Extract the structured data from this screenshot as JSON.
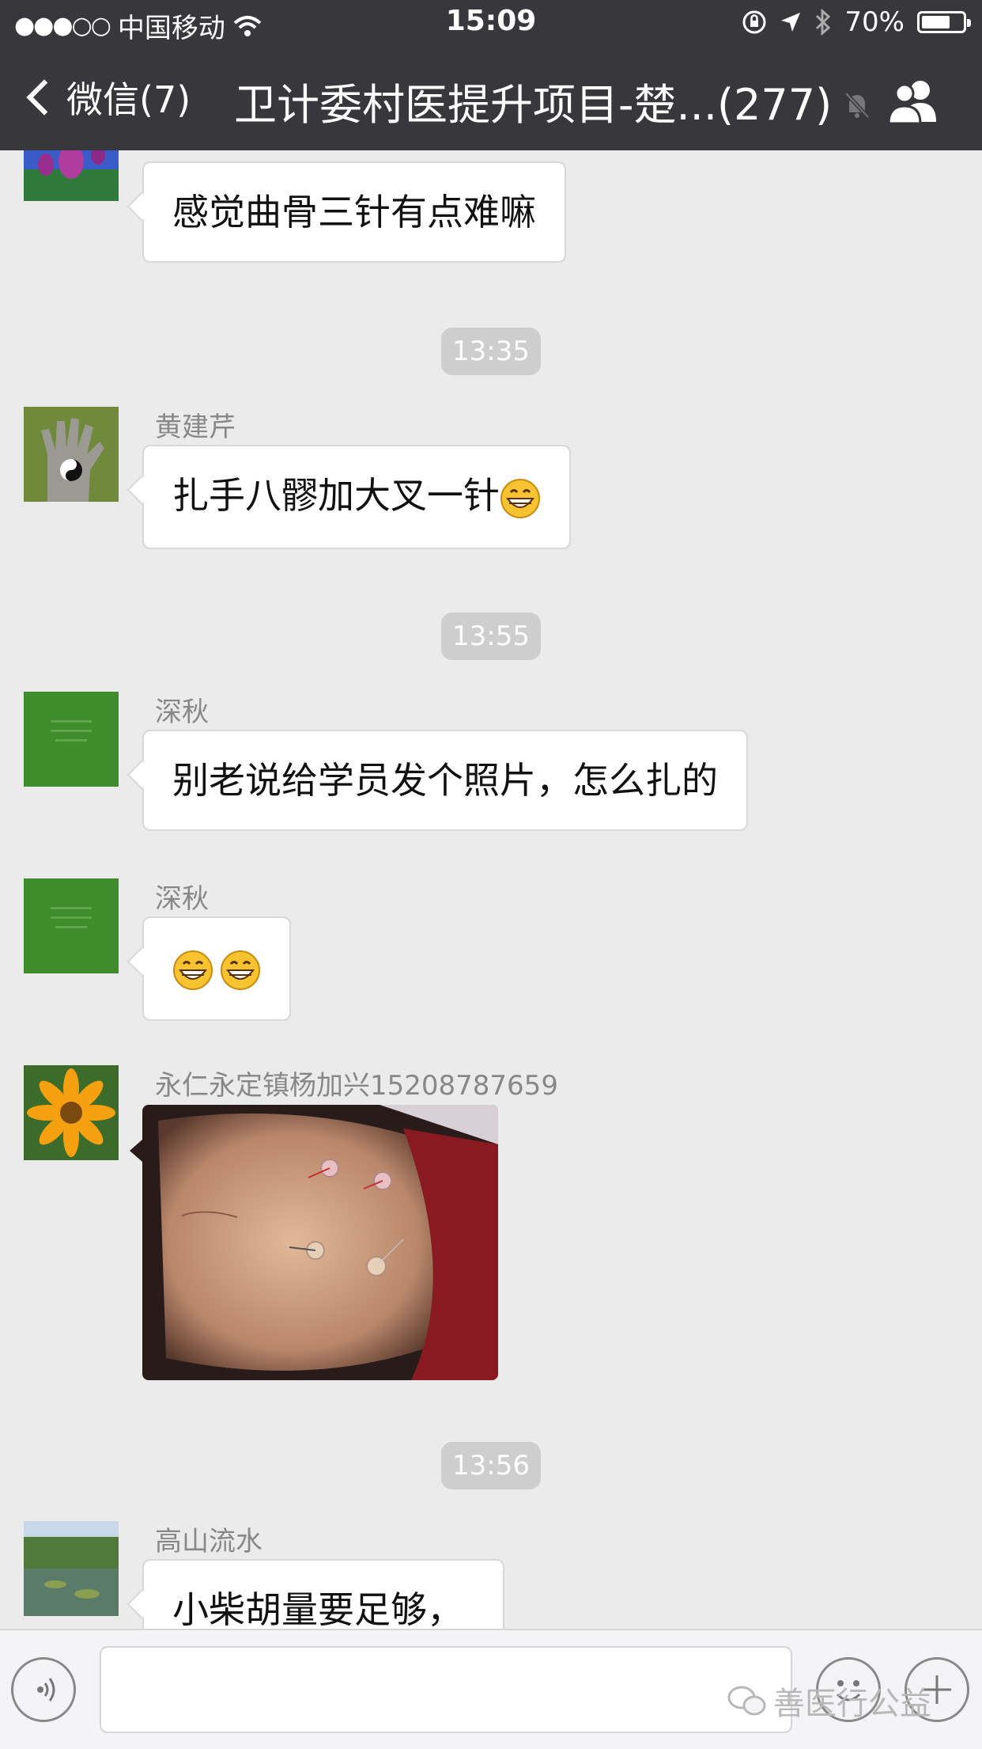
{
  "status_bar": {
    "carrier": "中国移动",
    "time": "15:09",
    "battery": "70%",
    "battery_level": 0.7
  },
  "nav": {
    "back_label": "微信(7)",
    "title": "卫计委村医提升项目-楚...(277)"
  },
  "messages": [
    {
      "sender": "",
      "text": "感觉曲骨三针有点难嘛"
    },
    {
      "time": "13:35"
    },
    {
      "sender": "黄建芹",
      "text": "扎手八髎加大叉一针",
      "emoji": "grin-emoji"
    },
    {
      "time": "13:55"
    },
    {
      "sender": "深秋",
      "text": "别老说给学员发个照片，怎么扎的"
    },
    {
      "sender": "深秋",
      "emoji": [
        "grin-emoji",
        "grin-emoji"
      ]
    },
    {
      "sender": "永仁永定镇杨加兴15208787659",
      "image": "acupuncture-photo"
    },
    {
      "time": "13:56"
    },
    {
      "sender": "高山流水",
      "text": "小柴胡量要足够，"
    }
  ],
  "input": {
    "watermark": "善医行公益"
  },
  "colors": {
    "nav_bg": "#38383c",
    "chat_bg": "#ebebeb",
    "bubble": "#ffffff",
    "time_pill": "#cecece"
  }
}
